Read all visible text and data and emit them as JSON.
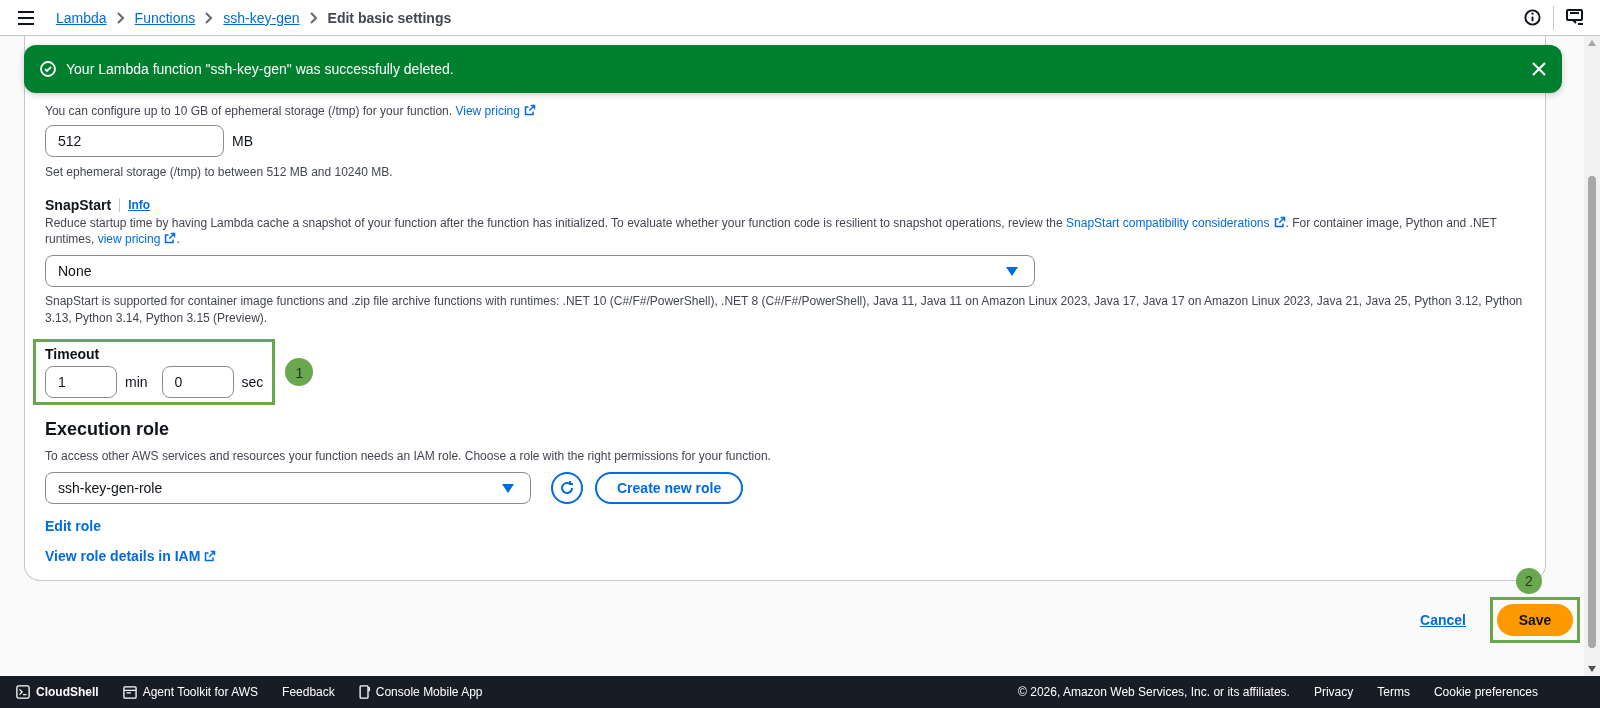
{
  "top_nav": {
    "breadcrumbs": [
      "Lambda",
      "Functions",
      "ssh-key-gen"
    ],
    "current": "Edit basic settings"
  },
  "flash": {
    "message": "Your Lambda function \"ssh-key-gen\" was successfully deleted."
  },
  "ephemeral_storage": {
    "description": {
      "text": "You can configure up to 10 GB of ephemeral storage (/tmp) for your function. ",
      "link": "View pricing"
    },
    "value": "512",
    "unit": "MB",
    "hint": "Set ephemeral storage (/tmp) to between 512 MB and 10240 MB."
  },
  "snapstart": {
    "label": "SnapStart",
    "info": "Info",
    "description": {
      "text_1": "Reduce startup time by having Lambda cache a snapshot of your function after the function has initialized. To evaluate whether your function code is resilient to snapshot operations, review the ",
      "link_1": "SnapStart compatibility considerations",
      "text_2": ". For container image, Python and .NET runtimes, ",
      "link_2": "view pricing",
      "text_3": "."
    },
    "value": "None",
    "note": "SnapStart is supported for container image functions and .zip file archive functions with runtimes: .NET 10 (C#/F#/PowerShell), .NET 8 (C#/F#/PowerShell), Java 11, Java 11 on Amazon Linux 2023, Java 17, Java 17 on Amazon Linux 2023, Java 21, Java 25, Python 3.12, Python 3.13, Python 3.14, Python 3.15 (Preview)."
  },
  "timeout": {
    "label": "Timeout",
    "minutes": "1",
    "minutes_unit": "min",
    "seconds": "0",
    "seconds_unit": "sec",
    "annotation": "1"
  },
  "execution_role": {
    "label": "Execution role",
    "description": "To access other AWS services and resources your function needs an IAM role. Choose a role with the right permissions for your function.",
    "value": "ssh-key-gen-role",
    "create_button": "Create new role",
    "edit_link": "Edit role",
    "details_link": "View role details in IAM"
  },
  "actions": {
    "cancel": "Cancel",
    "save": "Save",
    "annotation": "2"
  },
  "footer": {
    "left": [
      "CloudShell",
      "Agent Toolkit for AWS",
      "Feedback",
      "Console Mobile App"
    ],
    "right": [
      "© 2026, Amazon Web Services, Inc. or its affiliates.",
      "Privacy",
      "Terms",
      "Cookie preferences"
    ]
  }
}
